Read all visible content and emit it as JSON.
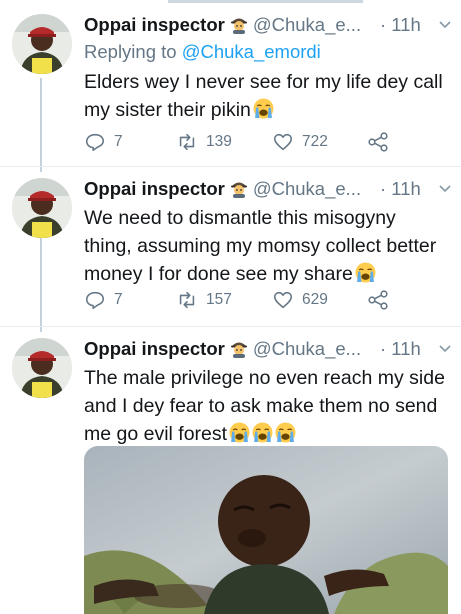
{
  "tweets": [
    {
      "author_name": "Oppai inspector",
      "badge_icon": "detective-emoji",
      "handle": "@Chuka_e...",
      "time": "· 11h",
      "reply_prefix": "Replying to",
      "reply_to": "@Chuka_emordi",
      "text_line1": "Elders wey I never see for my life dey call",
      "text_line2": "my sister their pikin",
      "trailing_emoji": "loudly-crying-face",
      "replies": "7",
      "retweets": "139",
      "likes": "722"
    },
    {
      "author_name": "Oppai inspector",
      "badge_icon": "detective-emoji",
      "handle": "@Chuka_e...",
      "time": "· 11h",
      "text_line1": "We need to dismantle this misogyny",
      "text_line2": "thing, assuming my momsy collect better",
      "text_line3": "money I for done see my share",
      "trailing_emoji": "loudly-crying-face",
      "replies": "7",
      "retweets": "157",
      "likes": "629"
    },
    {
      "author_name": "Oppai inspector",
      "badge_icon": "detective-emoji",
      "handle": "@Chuka_e...",
      "time": "· 11h",
      "text_line1": "The male privilege no even reach my side",
      "text_line2": "and I dey fear to ask make them no send",
      "text_line3": "me go evil forest",
      "trailing_emoji": "loudly-crying-face x3",
      "media": "photo-crying-child"
    }
  ],
  "colors": {
    "accent": "#1da1f2",
    "muted": "#657786",
    "text": "#14171a",
    "thread_line": "#c4d0da"
  }
}
